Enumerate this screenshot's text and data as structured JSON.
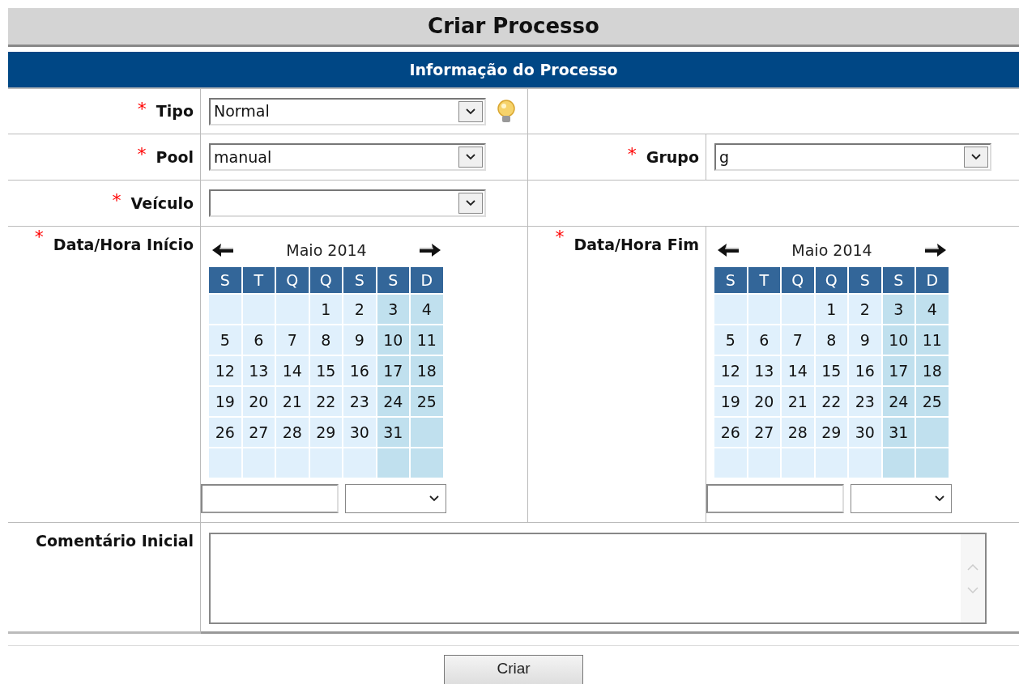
{
  "title": "Criar Processo",
  "section": "Informação do Processo",
  "fields": {
    "tipo": {
      "label": "Tipo",
      "required_mark": "*",
      "value": "Normal"
    },
    "pool": {
      "label": "Pool",
      "required_mark": "*",
      "value": "manual"
    },
    "grupo": {
      "label": "Grupo",
      "required_mark": "*",
      "value": "g"
    },
    "veiculo": {
      "label": "Veículo",
      "required_mark": "*"
    }
  },
  "dates": [
    {
      "label": "Data/Hora Início",
      "required_mark": "*",
      "month": "Maio 2014",
      "weekdays": [
        {
          "label": "S",
          "weekend": false
        },
        {
          "label": "T",
          "weekend": false
        },
        {
          "label": "Q",
          "weekend": false
        },
        {
          "label": "Q",
          "weekend": false
        },
        {
          "label": "S",
          "weekend": false
        },
        {
          "label": "S",
          "weekend": true
        },
        {
          "label": "D",
          "weekend": true
        }
      ],
      "weeks": [
        [
          "1",
          "2",
          "3",
          "4"
        ],
        [
          "5",
          "6",
          "7",
          "8",
          "9",
          "10",
          "11"
        ],
        [
          "12",
          "13",
          "14",
          "15",
          "16",
          "17",
          "18"
        ],
        [
          "19",
          "20",
          "21",
          "22",
          "23",
          "24",
          "25"
        ],
        [
          "26",
          "27",
          "28",
          "29",
          "30",
          "31"
        ]
      ]
    },
    {
      "label": "Data/Hora Fim",
      "required_mark": "*",
      "month": "Maio 2014",
      "weekdays": [
        {
          "label": "S",
          "weekend": false
        },
        {
          "label": "T",
          "weekend": false
        },
        {
          "label": "Q",
          "weekend": false
        },
        {
          "label": "Q",
          "weekend": false
        },
        {
          "label": "S",
          "weekend": false
        },
        {
          "label": "S",
          "weekend": true
        },
        {
          "label": "D",
          "weekend": true
        }
      ],
      "weeks": [
        [
          "1",
          "2",
          "3",
          "4"
        ],
        [
          "5",
          "6",
          "7",
          "8",
          "9",
          "10",
          "11"
        ],
        [
          "12",
          "13",
          "14",
          "15",
          "16",
          "17",
          "18"
        ],
        [
          "19",
          "20",
          "21",
          "22",
          "23",
          "24",
          "25"
        ],
        [
          "26",
          "27",
          "28",
          "29",
          "30",
          "31"
        ]
      ]
    }
  ],
  "comment": {
    "label": "Comentário Inicial"
  },
  "submit": "Criar"
}
